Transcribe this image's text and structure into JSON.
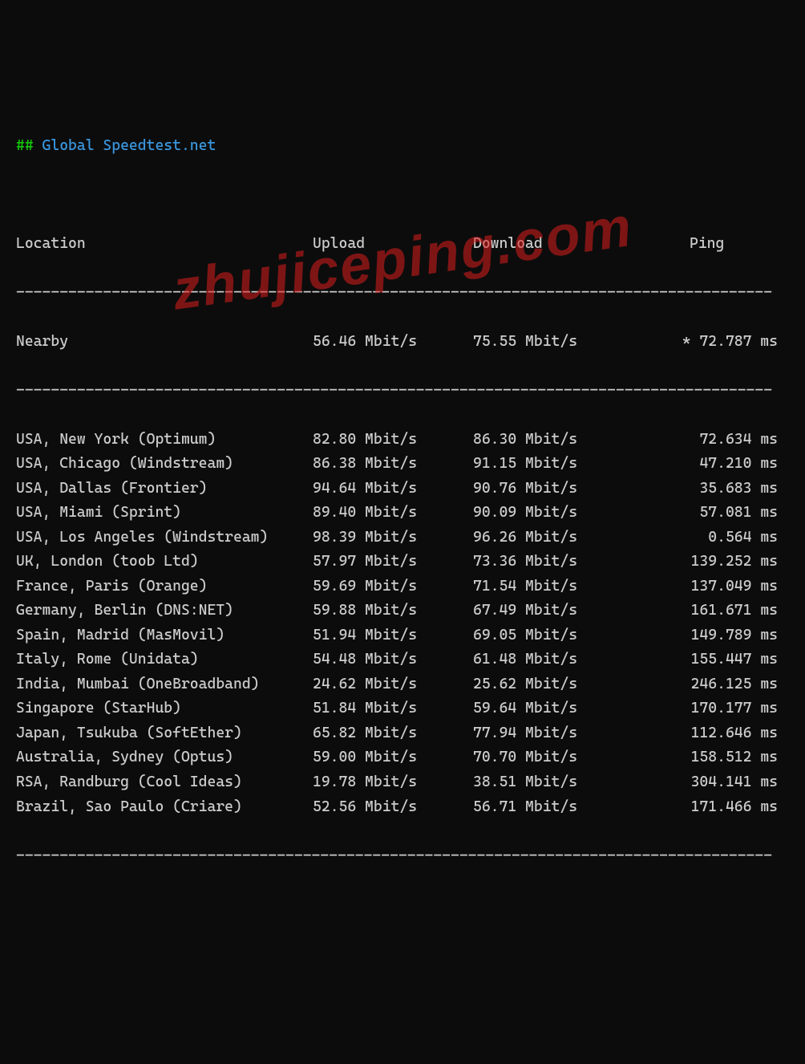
{
  "title": {
    "hash": "##",
    "text": "Global Speedtest.net"
  },
  "headers": {
    "location": "Location",
    "upload": "Upload",
    "download": "Download",
    "ping": "Ping"
  },
  "nearby": {
    "location": "Nearby",
    "upload": "56.46 Mbit/s",
    "download": "75.55 Mbit/s",
    "ping": "* 72.787 ms"
  },
  "rows": [
    {
      "location": "USA, New York (Optimum)",
      "upload": "82.80 Mbit/s",
      "download": "86.30 Mbit/s",
      "ping": "72.634 ms"
    },
    {
      "location": "USA, Chicago (Windstream)",
      "upload": "86.38 Mbit/s",
      "download": "91.15 Mbit/s",
      "ping": "47.210 ms"
    },
    {
      "location": "USA, Dallas (Frontier)",
      "upload": "94.64 Mbit/s",
      "download": "90.76 Mbit/s",
      "ping": "35.683 ms"
    },
    {
      "location": "USA, Miami (Sprint)",
      "upload": "89.40 Mbit/s",
      "download": "90.09 Mbit/s",
      "ping": "57.081 ms"
    },
    {
      "location": "USA, Los Angeles (Windstream)",
      "upload": "98.39 Mbit/s",
      "download": "96.26 Mbit/s",
      "ping": "0.564 ms"
    },
    {
      "location": "UK, London (toob Ltd)",
      "upload": "57.97 Mbit/s",
      "download": "73.36 Mbit/s",
      "ping": "139.252 ms"
    },
    {
      "location": "France, Paris (Orange)",
      "upload": "59.69 Mbit/s",
      "download": "71.54 Mbit/s",
      "ping": "137.049 ms"
    },
    {
      "location": "Germany, Berlin (DNS:NET)",
      "upload": "59.88 Mbit/s",
      "download": "67.49 Mbit/s",
      "ping": "161.671 ms"
    },
    {
      "location": "Spain, Madrid (MasMovil)",
      "upload": "51.94 Mbit/s",
      "download": "69.05 Mbit/s",
      "ping": "149.789 ms"
    },
    {
      "location": "Italy, Rome (Unidata)",
      "upload": "54.48 Mbit/s",
      "download": "61.48 Mbit/s",
      "ping": "155.447 ms"
    },
    {
      "location": "India, Mumbai (OneBroadband)",
      "upload": "24.62 Mbit/s",
      "download": "25.62 Mbit/s",
      "ping": "246.125 ms"
    },
    {
      "location": "Singapore (StarHub)",
      "upload": "51.84 Mbit/s",
      "download": "59.64 Mbit/s",
      "ping": "170.177 ms"
    },
    {
      "location": "Japan, Tsukuba (SoftEther)",
      "upload": "65.82 Mbit/s",
      "download": "77.94 Mbit/s",
      "ping": "112.646 ms"
    },
    {
      "location": "Australia, Sydney (Optus)",
      "upload": "59.00 Mbit/s",
      "download": "70.70 Mbit/s",
      "ping": "158.512 ms"
    },
    {
      "location": "RSA, Randburg (Cool Ideas)",
      "upload": "19.78 Mbit/s",
      "download": "38.51 Mbit/s",
      "ping": "304.141 ms"
    },
    {
      "location": "Brazil, Sao Paulo (Criare)",
      "upload": "52.56 Mbit/s",
      "download": "56.71 Mbit/s",
      "ping": "171.466 ms"
    }
  ],
  "dashes": "---------------------------------------------------------------------------------------",
  "watermark": "zhujiceping.com"
}
